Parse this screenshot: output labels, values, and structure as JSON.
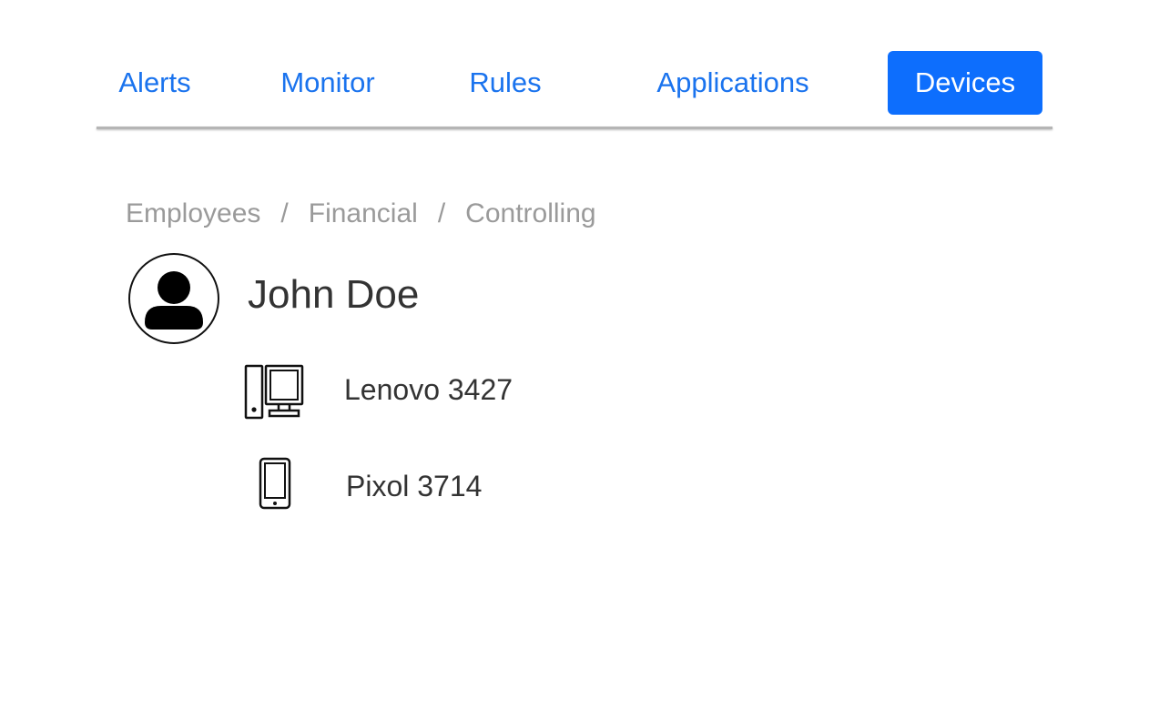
{
  "nav": {
    "tabs": [
      {
        "label": "Alerts"
      },
      {
        "label": "Monitor"
      },
      {
        "label": "Rules"
      },
      {
        "label": "Applications"
      },
      {
        "label": "Devices"
      }
    ],
    "active_tab": "Devices",
    "accent_color": "#0d6efd"
  },
  "breadcrumb": {
    "items": [
      "Employees",
      "Financial",
      "Controlling"
    ],
    "separator": "/"
  },
  "user": {
    "name": "John Doe",
    "avatar_icon": "user-avatar-icon"
  },
  "devices": [
    {
      "name": "Lenovo 3427",
      "icon": "desktop-computer-icon"
    },
    {
      "name": "Pixol 3714",
      "icon": "smartphone-icon"
    }
  ]
}
